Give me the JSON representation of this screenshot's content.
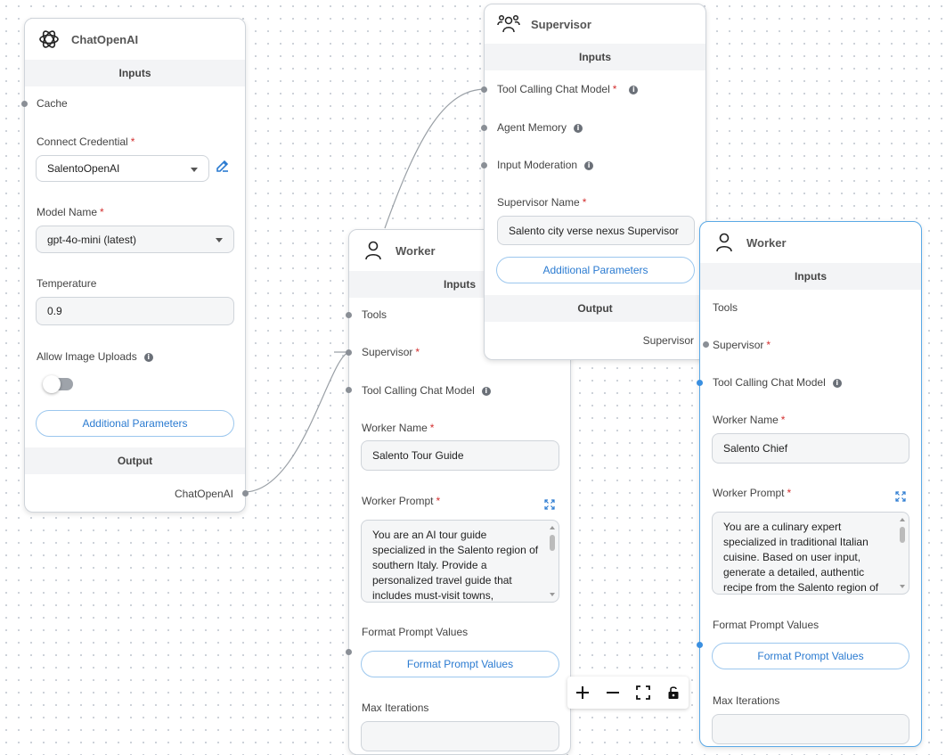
{
  "chat_openai": {
    "title": "ChatOpenAI",
    "inputs_label": "Inputs",
    "cache_label": "Cache",
    "credential_label": "Connect Credential",
    "credential_value": "SalentoOpenAI",
    "model_label": "Model Name",
    "model_value": "gpt-4o-mini (latest)",
    "temperature_label": "Temperature",
    "temperature_value": "0.9",
    "image_uploads_label": "Allow Image Uploads",
    "image_uploads_enabled": false,
    "additional_params_label": "Additional Parameters",
    "output_label": "Output",
    "output_anchor": "ChatOpenAI"
  },
  "supervisor": {
    "title": "Supervisor",
    "inputs_label": "Inputs",
    "tool_model_label": "Tool Calling Chat Model",
    "agent_memory_label": "Agent Memory",
    "input_moderation_label": "Input Moderation",
    "name_label": "Supervisor Name",
    "name_value": "Salento city verse nexus Supervisor",
    "additional_params_label": "Additional Parameters",
    "output_label": "Output",
    "output_anchor": "Supervisor"
  },
  "worker1": {
    "title": "Worker",
    "inputs_label": "Inputs",
    "tools_label": "Tools",
    "supervisor_label": "Supervisor",
    "tool_model_label": "Tool Calling Chat Model",
    "name_label": "Worker Name",
    "name_value": "Salento Tour Guide",
    "prompt_label": "Worker Prompt",
    "prompt_value": "You are an AI tour guide specialized in the Salento region of southern Italy. Provide a personalized travel guide that includes must-visit towns,",
    "format_label": "Format Prompt Values",
    "format_button": "Format Prompt Values",
    "max_iter_label": "Max Iterations"
  },
  "worker2": {
    "title": "Worker",
    "inputs_label": "Inputs",
    "tools_label": "Tools",
    "supervisor_label": "Supervisor",
    "tool_model_label": "Tool Calling Chat Model",
    "name_label": "Worker Name",
    "name_value": "Salento Chief",
    "prompt_label": "Worker Prompt",
    "prompt_value": "You are a culinary expert specialized in traditional Italian cuisine. Based on user input, generate a detailed, authentic recipe from the Salento region of",
    "format_label": "Format Prompt Values",
    "format_button": "Format Prompt Values",
    "max_iter_label": "Max Iterations"
  },
  "required_mark": "*",
  "info_glyph": "i",
  "colors": {
    "accent": "#2b7bd1",
    "required": "#d32f2f",
    "anchor": "#8a8f96",
    "anchor_active": "#3a8fe0"
  },
  "icons": [
    "openai-logo-icon",
    "supervisor-group-icon",
    "worker-person-icon",
    "info-icon",
    "edit-icon",
    "expand-icon",
    "zoom-in-icon",
    "zoom-out-icon",
    "fit-view-icon",
    "lock-icon"
  ]
}
